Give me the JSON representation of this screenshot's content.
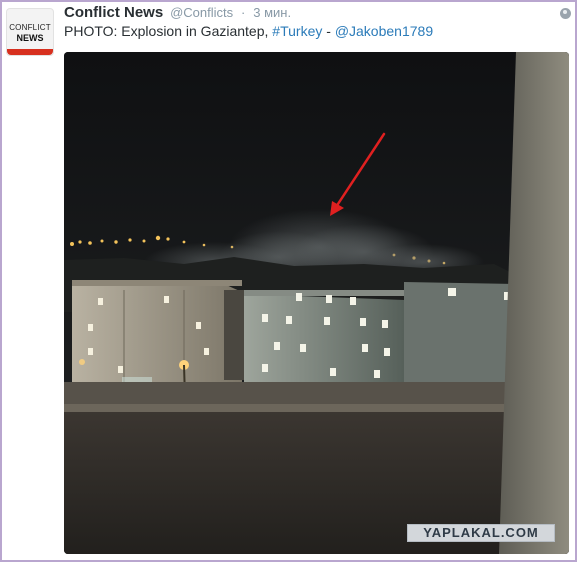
{
  "tweet": {
    "author_name": "Conflict News",
    "author_handle": "@Conflicts",
    "separator": "·",
    "time": "3 мин.",
    "text_before": "PHOTO: Explosion in Gaziantep,",
    "hashtag": "#Turkey",
    "dash": "-",
    "mention": "@Jakoben1789",
    "globe_icon": "globe-icon"
  },
  "avatar": {
    "line1": "CONFLICT",
    "line2": "NEWS",
    "accent": "#d7301f"
  },
  "watermark": "YAPLAKAL.COM",
  "colors": {
    "link": "#2b7bb9",
    "name": "#292f33",
    "meta": "#8899a6",
    "frame": "#b9a6cf",
    "arrow": "#e02020"
  }
}
